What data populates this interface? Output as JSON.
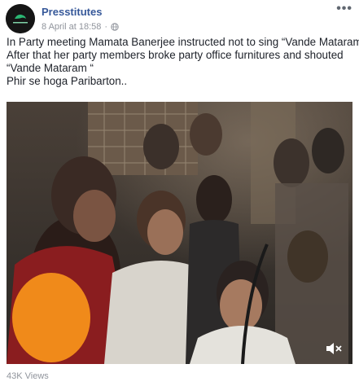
{
  "post": {
    "page_name": "Presstitutes",
    "timestamp": "8 April at 18:58",
    "separator": "·",
    "more_label": "•••",
    "text_lines": [
      "In Party meeting Mamata Banerjee instructed not to sing “Vande Mataram “",
      "After that her party members broke party office furnitures and shouted",
      "“Vande Mataram “",
      "Phir se hoga Paribarton.."
    ],
    "views": "43K Views"
  },
  "icons": {
    "avatar": "page-logo-avatar",
    "privacy": "globe-icon",
    "more": "more-options-icon",
    "mute": "speaker-muted-icon"
  },
  "colors": {
    "link": "#365899",
    "meta": "#90949c",
    "text": "#1d2129"
  }
}
